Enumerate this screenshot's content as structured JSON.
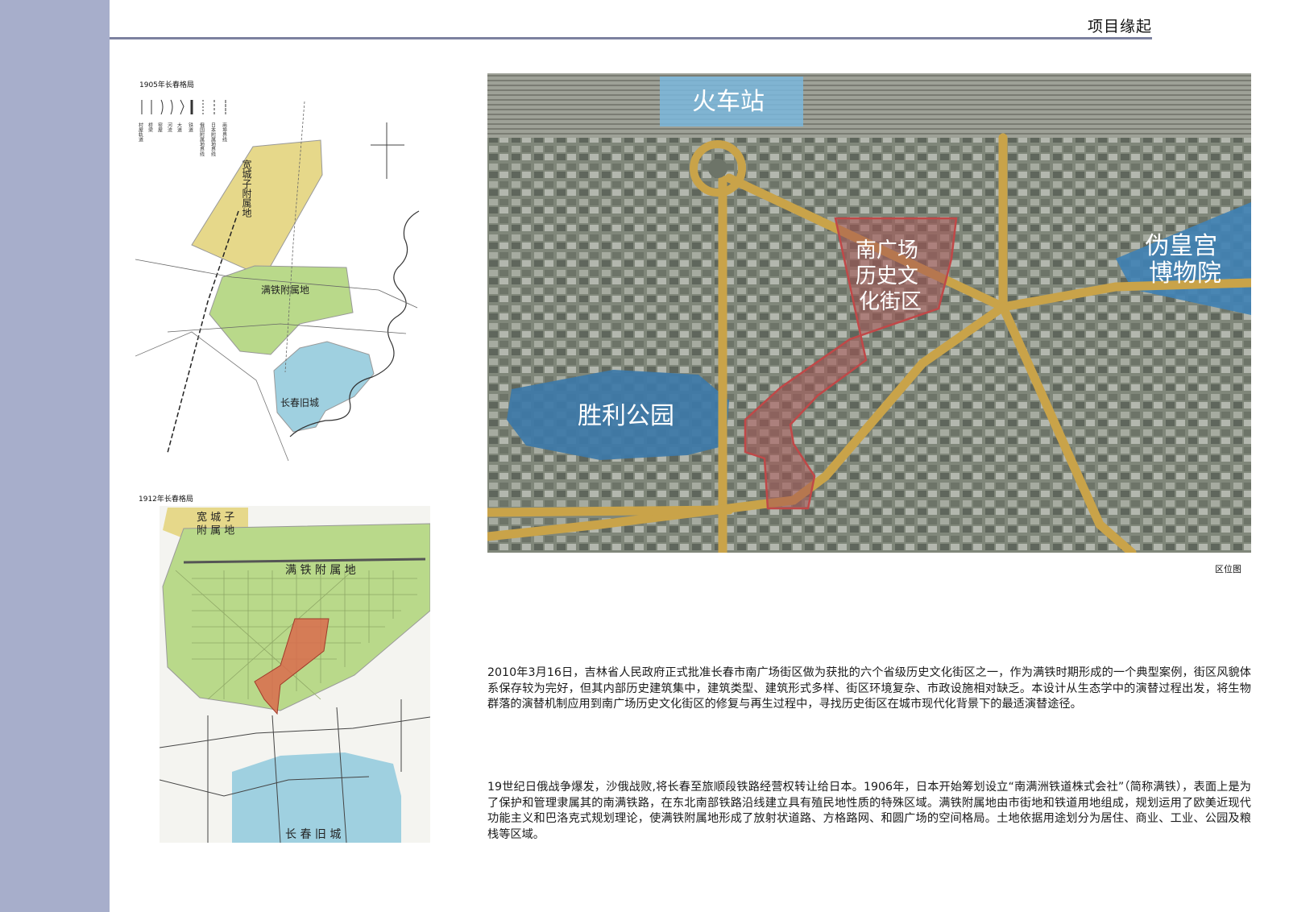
{
  "header": {
    "title": "项目缘起"
  },
  "map_1905": {
    "caption": "1905年长春格局",
    "legend": [
      "商埠界线",
      "日本附属地界线",
      "俄国附属地界线",
      "铁道",
      "大道",
      "河流",
      "窑屋",
      "桥梁",
      "村屋轨道"
    ],
    "zones": {
      "kuancheng": "宽城子附属地",
      "mantie": "满铁附属地",
      "old_city": "长春旧城"
    }
  },
  "map_1912": {
    "caption": "1912年长春格局",
    "zones": {
      "kuancheng": "宽 城 子\n附 属 地",
      "mantie": "满 铁 附 属 地",
      "old_city": "长 春 旧 城"
    }
  },
  "location_map": {
    "labels": {
      "station": "火车站",
      "district": "南广场\n历史文\n化街区",
      "museum": "伪皇宫\n博物院",
      "park": "胜利公园"
    },
    "caption": "区位图"
  },
  "paragraphs": [
    "2010年3月16日，吉林省人民政府正式批准长春市南广场街区做为获批的六个省级历史文化街区之一，作为满铁时期形成的一个典型案例，街区风貌体系保存较为完好，但其内部历史建筑集中，建筑类型、建筑形式多样、街区环境复杂、市政设施相对缺乏。本设计从生态学中的演替过程出发，将生物群落的演替机制应用到南广场历史文化街区的修复与再生过程中，寻找历史街区在城市现代化背景下的最适演替途径。",
    "19世纪日俄战争爆发，沙俄战败,将长春至旅顺段铁路经营权转让给日本。1906年，日本开始筹划设立“南满洲铁道株式会社”（简称满铁），表面上是为了保护和管理隶属其的南满铁路，在东北南部铁路沿线建立具有殖民地性质的特殊区域。满铁附属地由市街地和铁道用地组成，规划运用了欧美近现代功能主义和巴洛克式规划理论，使满铁附属地形成了放射状道路、方格路网、和圆广场的空间格局。土地依据用途划分为居住、商业、工业、公园及粮栈等区域。"
  ],
  "colors": {
    "sidebar": "#a7aecb",
    "kuancheng_zone": "#e6d88a",
    "mantie_zone": "#b9d98a",
    "old_city_zone": "#9fd0e0",
    "district_outline": "#b84848",
    "road_gold": "#c9a349",
    "label_blue": "#3c78a8"
  }
}
